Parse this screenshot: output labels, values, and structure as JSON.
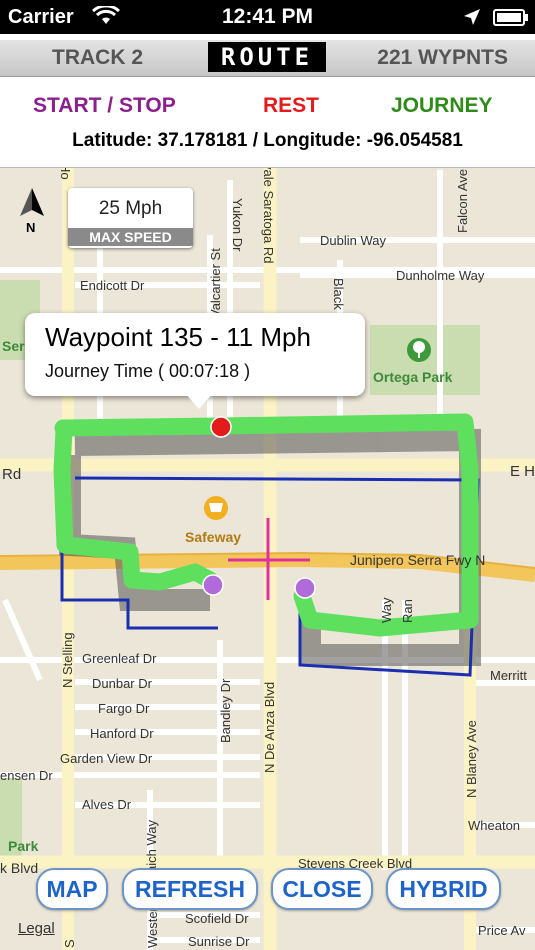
{
  "status": {
    "carrier": "Carrier",
    "time": "12:41 PM"
  },
  "header": {
    "track": "TRACK 2",
    "mode": "ROUTE",
    "waypoints": "221 WYPNTS",
    "legend": {
      "start_stop": "START / STOP",
      "rest": "REST",
      "journey": "JOURNEY"
    },
    "coordinates": "Latitude: 37.178181 / Longitude: -96.054581"
  },
  "colors": {
    "start_stop": "#8b1f8b",
    "rest": "#e31b1b",
    "journey": "#2e8b1a",
    "path": "#5ee05e",
    "outline": "#1a2fb0"
  },
  "map": {
    "compass_label": "N",
    "max_speed": {
      "value": "25 Mph",
      "caption": "MAX SPEED"
    },
    "callout": {
      "title": "Waypoint 135 - 11 Mph",
      "subtitle": "Journey Time ( 00:07:18 )"
    },
    "streets": {
      "dublin": "Dublin Way",
      "dunholme": "Dunholme Way",
      "endicott": "Endicott Dr",
      "greenleaf": "Greenleaf Dr",
      "dunbar": "Dunbar Dr",
      "fargo": "Fargo Dr",
      "hanford": "Hanford Dr",
      "garden": "Garden View Dr",
      "alves": "Alves Dr",
      "scofield": "Scofield Dr",
      "sunrise": "Sunrise Dr",
      "merritt": "Merritt",
      "wheaton": "Wheaton",
      "price": "Price Av",
      "junipero": "Junipero Serra Fwy N",
      "stevens": "Stevens Creek Blvd",
      "ehom": "E Ho",
      "rd": "Rd",
      "sensen": "ensen Dr",
      "kblvd": "k Blvd",
      "vale": "vale Saratoga Rd",
      "yukon": "Yukon Dr",
      "valcartier": "Valcartier St",
      "falcon": "Falcon Ave",
      "bandley": "Bandley Dr",
      "deanza": "N De Anza Blvd",
      "blaney": "N Blaney Ave",
      "stelling": "N Stelling",
      "black": "Black",
      "way": "Way",
      "ran": "Ran",
      "aich": "aich Way",
      "western": "Western",
      "ho": "Ho",
      "s": "S"
    },
    "places": {
      "ortega": "Ortega Park",
      "safeway": "Safeway",
      "ser": "Ser",
      "park": "Park"
    },
    "legal": "Legal"
  },
  "buttons": {
    "map": "MAP",
    "refresh": "REFRESH",
    "close": "CLOSE",
    "hybrid": "HYBRID"
  }
}
